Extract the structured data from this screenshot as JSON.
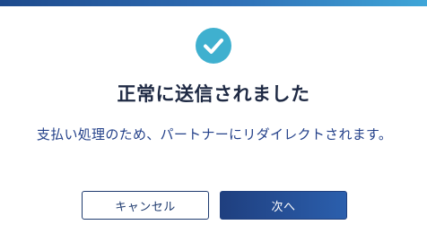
{
  "dialog": {
    "title": "正常に送信されました",
    "message": "支払い処理のため、パートナーにリダイレクトされます。",
    "icon": "check-circle-icon",
    "accent_color": "#3fb0cf"
  },
  "actions": {
    "cancel_label": "キャンセル",
    "next_label": "次へ"
  }
}
